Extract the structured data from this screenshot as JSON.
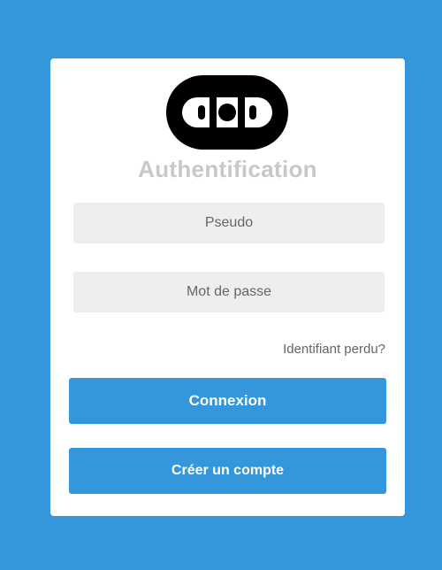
{
  "logo": {
    "icon": "cod-logo-icon",
    "text": "COD"
  },
  "login": {
    "title": "Authentification",
    "username_placeholder": "Pseudo",
    "password_placeholder": "Mot de passe",
    "forgot_label": "Identifiant perdu?",
    "submit_label": "Connexion",
    "signup_label": "Créer un compte"
  },
  "colors": {
    "background": "#3497db",
    "button": "#3497db",
    "title": "#c8c8c8",
    "field_bg": "#eceef0"
  }
}
